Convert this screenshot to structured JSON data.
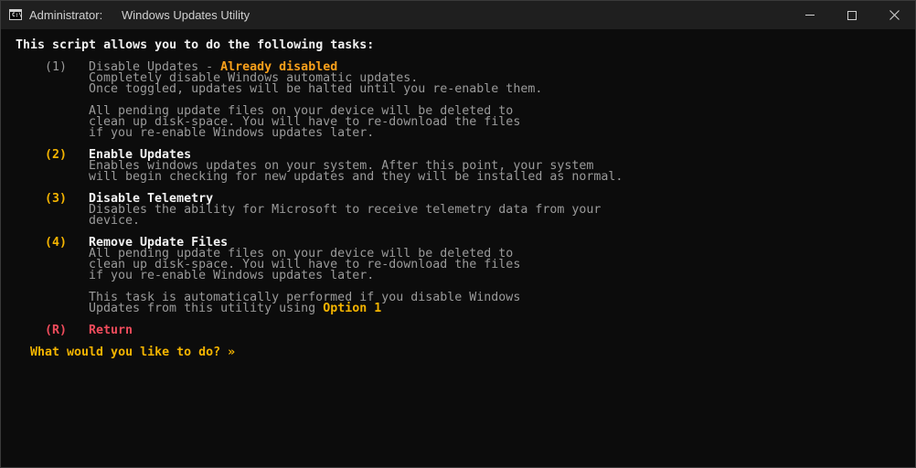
{
  "window": {
    "user_label": "Administrator:",
    "tab_title": "Windows Updates Utility",
    "icon": "cmd-console-icon",
    "icon_text": "C:\\"
  },
  "intro": "This script allows you to do the following tasks:",
  "options": [
    {
      "key": "(1)",
      "title": "Disable Updates",
      "separator": " - ",
      "status": "Already disabled",
      "lines": [
        "Completely disable Windows automatic updates.",
        "Once toggled, updates will be halted until you re-enable them.",
        "",
        "All pending update files on your device will be deleted to",
        "clean up disk-space. You will have to re-download the files",
        "if you re-enable Windows updates later."
      ]
    },
    {
      "key": "(2)",
      "title": "Enable Updates",
      "lines": [
        "Enables windows updates on your system. After this point, your system",
        "will begin checking for new updates and they will be installed as normal."
      ]
    },
    {
      "key": "(3)",
      "title": "Disable Telemetry",
      "lines": [
        "Disables the ability for Microsoft to receive telemetry data from your",
        "device."
      ]
    },
    {
      "key": "(4)",
      "title": "Remove Update Files",
      "lines": [
        "All pending update files on your device will be deleted to",
        "clean up disk-space. You will have to re-download the files",
        "if you re-enable Windows updates later.",
        "",
        "This task is automatically performed if you disable Windows"
      ],
      "last_line_prefix": "Updates from this utility using ",
      "last_line_highlight": "Option 1"
    },
    {
      "key": "(R)",
      "title": "Return"
    }
  ],
  "prompt": "What would you like to do? »",
  "colors": {
    "background": "#0c0c0c",
    "titlebar": "#1f1f1f",
    "text_white": "#f2f2f2",
    "text_gray": "#9a9a9a",
    "highlight_yellow": "#f4b400",
    "highlight_orange": "#f9a01b",
    "return_red": "#f04c5c"
  }
}
